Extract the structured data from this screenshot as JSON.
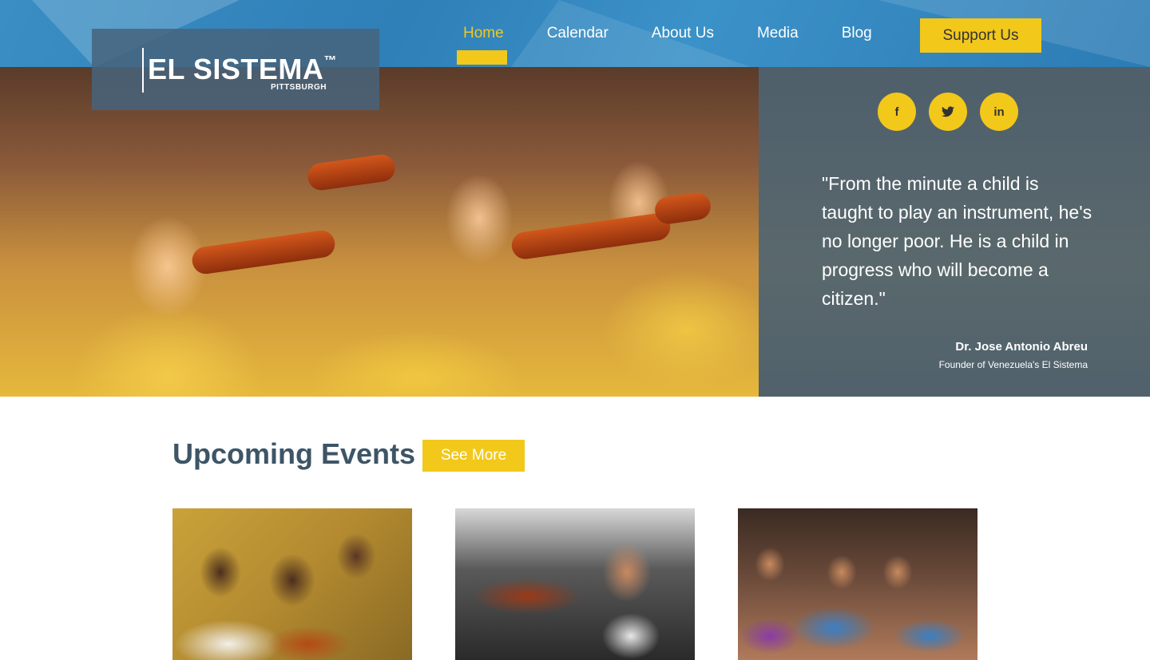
{
  "brand": {
    "name": "EL SISTEMA",
    "trademark": "™",
    "subtitle": "PITTSBURGH"
  },
  "nav": {
    "items": [
      {
        "label": "Home",
        "active": true
      },
      {
        "label": "Calendar",
        "active": false
      },
      {
        "label": "About Us",
        "active": false
      },
      {
        "label": "Media",
        "active": false
      },
      {
        "label": "Blog",
        "active": false
      }
    ],
    "cta_label": "Support Us"
  },
  "social": {
    "facebook": "f",
    "twitter": "🐦",
    "linkedin": "in"
  },
  "quote": {
    "text": "\"From the minute a child is taught to play an instrument, he's no longer poor. He is a child in progress who will become a citizen.\"",
    "author": "Dr. Jose Antonio Abreu",
    "role": "Founder of Venezuela's El Sistema"
  },
  "events": {
    "title": "Upcoming Events |",
    "see_more_label": "See More"
  },
  "colors": {
    "accent": "#f2c81b",
    "header_blue": "#3389c1",
    "title_text": "#3d5566",
    "quote_panel": "#4a6073"
  }
}
